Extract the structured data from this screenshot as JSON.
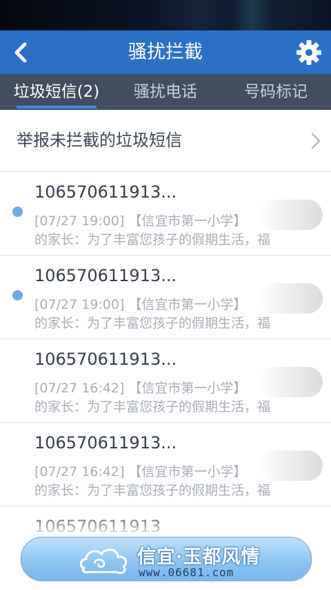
{
  "header": {
    "title": "骚扰拦截"
  },
  "tabs": [
    {
      "label": "垃圾短信(2)",
      "active": true
    },
    {
      "label": "骚扰电话",
      "active": false
    },
    {
      "label": "号码标记",
      "active": false
    }
  ],
  "report": {
    "label": "举报未拦截的垃圾短信"
  },
  "messages": [
    {
      "sender": "106570611913...",
      "line1": "[07/27 19:00] 【信宜市第一小学】",
      "line2": "的家长：为了丰富您孩子的假期生活，福",
      "unread": true
    },
    {
      "sender": "106570611913...",
      "line1": "[07/27 19:00] 【信宜市第一小学】",
      "line2": "的家长：为了丰富您孩子的假期生活，福",
      "unread": true
    },
    {
      "sender": "106570611913...",
      "line1": "[07/27 16:42] 【信宜市第一小学】",
      "line2": "的家长：为了丰富您孩子的假期生活，福",
      "unread": false
    },
    {
      "sender": "106570611913...",
      "line1": "[07/27 16:42] 【信宜市第一小学】",
      "line2": "的家长：为了丰富您孩子的假期生活，福",
      "unread": false
    },
    {
      "sender": "106570611913",
      "line1": "",
      "line2": "",
      "unread": false
    }
  ],
  "watermark": {
    "title": "信宜·玉都风情",
    "url": "www.06681.com"
  },
  "colors": {
    "titlebar": "#2b6fc6",
    "tabs": "#424e5f",
    "indicator": "#3b8fe0",
    "unread_dot": "#6fa8e6"
  }
}
